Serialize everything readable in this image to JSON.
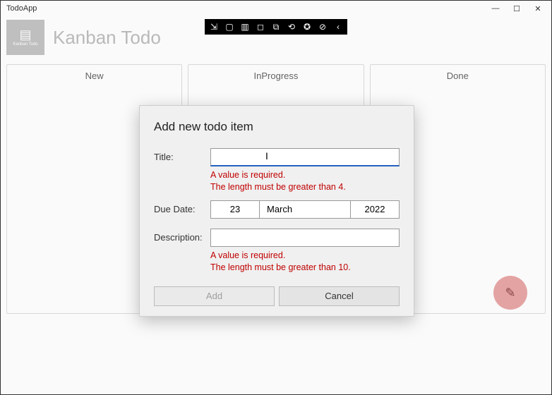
{
  "window": {
    "title": "TodoApp"
  },
  "header": {
    "logo_text": "Kanban Todo",
    "app_title": "Kanban Todo"
  },
  "columns": [
    {
      "name": "New"
    },
    {
      "name": "InProgress"
    },
    {
      "name": "Done"
    }
  ],
  "dialog": {
    "heading": "Add new todo item",
    "title_label": "Title:",
    "title_value": "",
    "title_error1": "A value is required.",
    "title_error2": "The length must be greater than 4.",
    "due_label": "Due Date:",
    "due_day": "23",
    "due_month": "March",
    "due_year": "2022",
    "desc_label": "Description:",
    "desc_value": "",
    "desc_error1": "A value is required.",
    "desc_error2": "The length must be greater than 10.",
    "add_label": "Add",
    "cancel_label": "Cancel"
  },
  "fab": {
    "icon": "✎"
  }
}
